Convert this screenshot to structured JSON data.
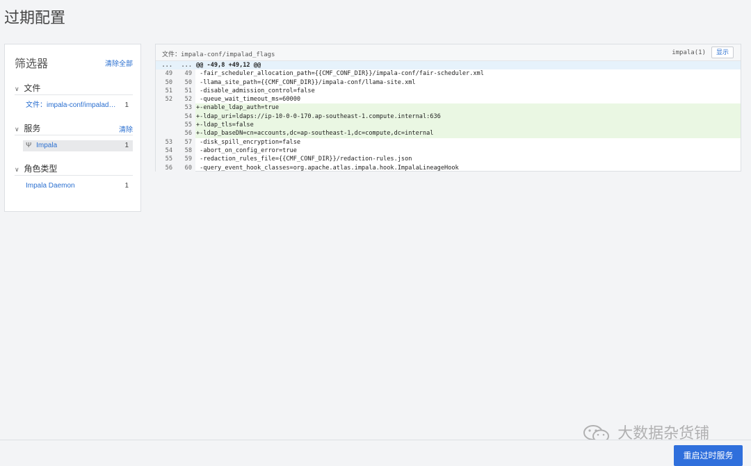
{
  "page": {
    "title": "过期配置"
  },
  "filters": {
    "title": "筛选器",
    "clear_all": "清除全部",
    "sections": {
      "file": {
        "title": "文件",
        "items": [
          {
            "label": "文件：impala-conf/impalad_flags",
            "count": "1"
          }
        ]
      },
      "service": {
        "title": "服务",
        "clear": "清除",
        "items": [
          {
            "label": "Impala",
            "count": "1"
          }
        ]
      },
      "role_type": {
        "title": "角色类型",
        "items": [
          {
            "label": "Impala Daemon",
            "count": "1"
          }
        ]
      }
    }
  },
  "diff": {
    "file_label": "文件：impala-conf/impalad_flags",
    "host": "impala(1)",
    "show_button": "显示",
    "lines": [
      {
        "type": "hunk",
        "old": "...",
        "new": "...",
        "text": "@@ -49,8 +49,12 @@"
      },
      {
        "type": "ctx",
        "old": "49",
        "new": "49",
        "text": " -fair_scheduler_allocation_path={{CMF_CONF_DIR}}/impala-conf/fair-scheduler.xml"
      },
      {
        "type": "ctx",
        "old": "50",
        "new": "50",
        "text": " -llama_site_path={{CMF_CONF_DIR}}/impala-conf/llama-site.xml"
      },
      {
        "type": "ctx",
        "old": "51",
        "new": "51",
        "text": " -disable_admission_control=false"
      },
      {
        "type": "ctx",
        "old": "52",
        "new": "52",
        "text": " -queue_wait_timeout_ms=60000"
      },
      {
        "type": "add",
        "old": "",
        "new": "53",
        "text": "+-enable_ldap_auth=true"
      },
      {
        "type": "add",
        "old": "",
        "new": "54",
        "text": "+-ldap_uri=ldaps://ip-10-0-0-170.ap-southeast-1.compute.internal:636"
      },
      {
        "type": "add",
        "old": "",
        "new": "55",
        "text": "+-ldap_tls=false"
      },
      {
        "type": "add",
        "old": "",
        "new": "56",
        "text": "+-ldap_baseDN=cn=accounts,dc=ap-southeast-1,dc=compute,dc=internal"
      },
      {
        "type": "ctx",
        "old": "53",
        "new": "57",
        "text": " -disk_spill_encryption=false"
      },
      {
        "type": "ctx",
        "old": "54",
        "new": "58",
        "text": " -abort_on_config_error=true"
      },
      {
        "type": "ctx",
        "old": "55",
        "new": "59",
        "text": " -redaction_rules_file={{CMF_CONF_DIR}}/redaction-rules.json"
      },
      {
        "type": "ctx",
        "old": "56",
        "new": "60",
        "text": " -query_event_hook_classes=org.apache.atlas.impala.hook.ImpalaLineageHook"
      }
    ]
  },
  "footer": {
    "restart_button": "重启过时服务"
  },
  "watermark": {
    "text": "大数据杂货铺"
  },
  "colors": {
    "accent": "#2f6fdc",
    "link": "#2a6fd0",
    "added_bg": "#eaf7e3",
    "hunk_bg": "#e6f2fb"
  }
}
